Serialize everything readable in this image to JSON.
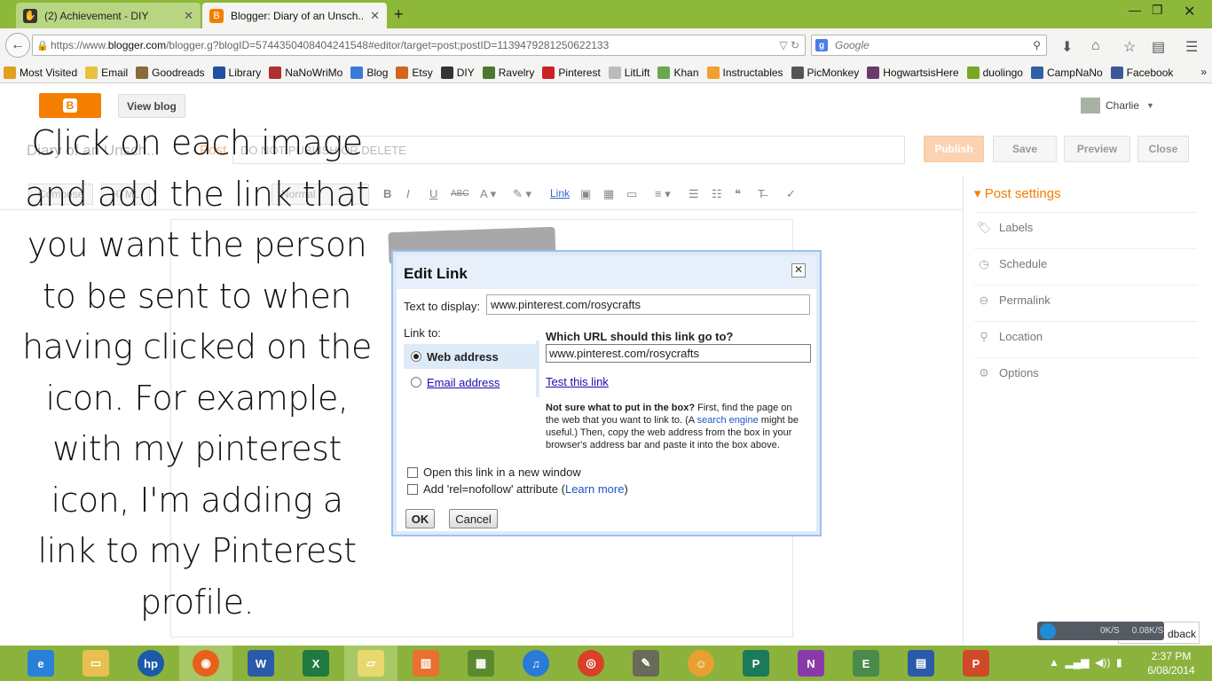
{
  "browser": {
    "tabs": [
      {
        "title": "(2) Achievement - DIY",
        "active": false
      },
      {
        "title": "Blogger: Diary of an Unsch...",
        "active": true
      }
    ],
    "url_prefix": "https://www.",
    "url_domain": "blogger.com",
    "url_rest": "/blogger.g?blogID=5744350408404241548#editor/target=post;postID=1139479281250622133",
    "search_placeholder": "Google",
    "bookmarks": [
      {
        "label": "Most Visited",
        "icon": "star-icon",
        "color": "#e0a020"
      },
      {
        "label": "Email",
        "icon": "email-icon",
        "color": "#e8c040"
      },
      {
        "label": "Goodreads",
        "icon": "goodreads-icon",
        "color": "#8a6a3a"
      },
      {
        "label": "Library",
        "icon": "library-icon",
        "color": "#2050a0"
      },
      {
        "label": "NaNoWriMo",
        "icon": "nanowrimo-icon",
        "color": "#b03030"
      },
      {
        "label": "Blog",
        "icon": "blog-icon",
        "color": "#3a7ad8"
      },
      {
        "label": "Etsy",
        "icon": "etsy-icon",
        "color": "#d5641c"
      },
      {
        "label": "DIY",
        "icon": "diy-icon",
        "color": "#333333"
      },
      {
        "label": "Ravelry",
        "icon": "ravelry-icon",
        "color": "#4a7a30"
      },
      {
        "label": "Pinterest",
        "icon": "pinterest-icon",
        "color": "#cb2027"
      },
      {
        "label": "LitLift",
        "icon": "litlift-icon",
        "color": "#bbbbbb"
      },
      {
        "label": "Khan",
        "icon": "khan-icon",
        "color": "#6aa84f"
      },
      {
        "label": "Instructables",
        "icon": "instructables-icon",
        "color": "#f0a030"
      },
      {
        "label": "PicMonkey",
        "icon": "picmonkey-icon",
        "color": "#555555"
      },
      {
        "label": "HogwartsisHere",
        "icon": "hogwarts-icon",
        "color": "#6a3a6a"
      },
      {
        "label": "duolingo",
        "icon": "duolingo-icon",
        "color": "#7aa820"
      },
      {
        "label": "CampNaNo",
        "icon": "campnano-icon",
        "color": "#3060a8"
      },
      {
        "label": "Facebook",
        "icon": "facebook-icon",
        "color": "#3b5998"
      }
    ]
  },
  "blogger": {
    "view_blog": "View blog",
    "user": "Charlie",
    "blog_name": "Diary of an Unsch...",
    "post_label": "· Post",
    "post_title": "DO NOT PUBLISH OR DELETE",
    "publish": "Publish",
    "save": "Save",
    "preview": "Preview",
    "close": "Close",
    "compose": "Compose",
    "html": "HTML",
    "font_size": "Normal",
    "link": "Link",
    "post_settings": "Post settings",
    "settings": [
      "Labels",
      "Schedule",
      "Permalink",
      "Location",
      "Options"
    ]
  },
  "instruction": "Click on each image and add the link that you want the person to be sent to when having clicked on the icon. For example, with my pinterest icon, I'm adding a link to my Pinterest profile.",
  "dialog": {
    "title": "Edit Link",
    "text_to_display_label": "Text to display:",
    "text_to_display_value": "www.pinterest.com/rosycrafts",
    "link_to_label": "Link to:",
    "option_web": "Web address",
    "option_email": "Email address",
    "url_question": "Which URL should this link go to?",
    "url_value": "www.pinterest.com/rosycrafts",
    "test_link": "Test this link",
    "help_bold": "Not sure what to put in the box?",
    "help_1": " First, find the page on the web that you want to link to. (A ",
    "help_link": "search engine",
    "help_2": " might be useful.) Then, copy the web address from the box in your browser's address bar and paste it into the box above.",
    "new_window": "Open this link in a new window",
    "nofollow_pre": "Add 'rel=nofollow' attribute (",
    "learn_more": "Learn more",
    "nofollow_post": ")",
    "ok": "OK",
    "cancel": "Cancel"
  },
  "widget": {
    "down": "0K/S",
    "up": "0.08K/S",
    "feedback": "dback"
  },
  "taskbar": {
    "time": "2:37 PM",
    "date": "6/08/2014"
  }
}
